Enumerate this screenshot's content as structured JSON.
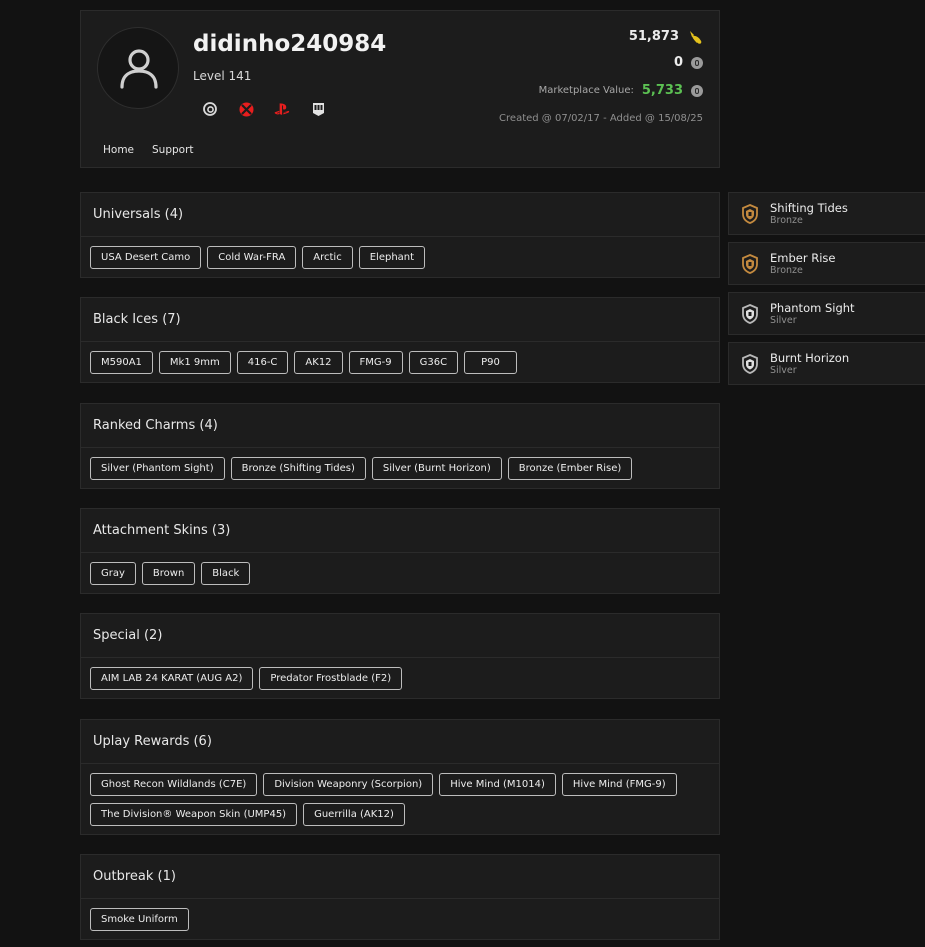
{
  "profile": {
    "username": "didinho240984",
    "level": "Level 141",
    "renown": "51,873",
    "credits": "0",
    "marketplace_label": "Marketplace Value:",
    "marketplace_value": "5,733",
    "created": "Created @ 07/02/17 - Added @ 15/08/25",
    "platforms": [
      "ubisoft-icon",
      "xbox-icon",
      "playstation-icon",
      "epic-games-icon"
    ],
    "nav": [
      "Home",
      "Support"
    ]
  },
  "colors": {
    "background": "#121212",
    "panel": "#1c1c1c",
    "accent_green": "#5cc153",
    "xbox_red": "#e81e1e",
    "playstation_red": "#e81e1e",
    "bronze": "#c48a3f",
    "silver": "#b8b8b8",
    "renown_gold": "#e4c21d"
  },
  "sections": [
    {
      "title": "Universals (4)",
      "items": [
        "USA Desert Camo",
        "Cold War-FRA",
        "Arctic",
        "Elephant"
      ]
    },
    {
      "title": "Black Ices (7)",
      "items": [
        "M590A1",
        "Mk1 9mm",
        "416-C",
        "AK12",
        "FMG-9",
        "G36C",
        "P90"
      ]
    },
    {
      "title": "Ranked Charms (4)",
      "items": [
        "Silver (Phantom Sight)",
        "Bronze (Shifting Tides)",
        "Silver (Burnt Horizon)",
        "Bronze (Ember Rise)"
      ]
    },
    {
      "title": "Attachment Skins (3)",
      "items": [
        "Gray",
        "Brown",
        "Black"
      ]
    },
    {
      "title": "Special (2)",
      "items": [
        "AIM LAB 24 KARAT (AUG A2)",
        "Predator Frostblade (F2)"
      ]
    },
    {
      "title": "Uplay Rewards (6)",
      "items": [
        "Ghost Recon Wildlands (C7E)",
        "Division Weaponry (Scorpion)",
        "Hive Mind (M1014)",
        "Hive Mind (FMG-9)",
        "The Division® Weapon Skin (UMP45)",
        "Guerrilla (AK12)"
      ]
    },
    {
      "title": "Outbreak (1)",
      "items": [
        "Smoke Uniform"
      ]
    }
  ],
  "ranks": [
    {
      "season": "Shifting Tides",
      "tier": "Bronze"
    },
    {
      "season": "Ember Rise",
      "tier": "Bronze"
    },
    {
      "season": "Phantom Sight",
      "tier": "Silver"
    },
    {
      "season": "Burnt Horizon",
      "tier": "Silver"
    }
  ]
}
